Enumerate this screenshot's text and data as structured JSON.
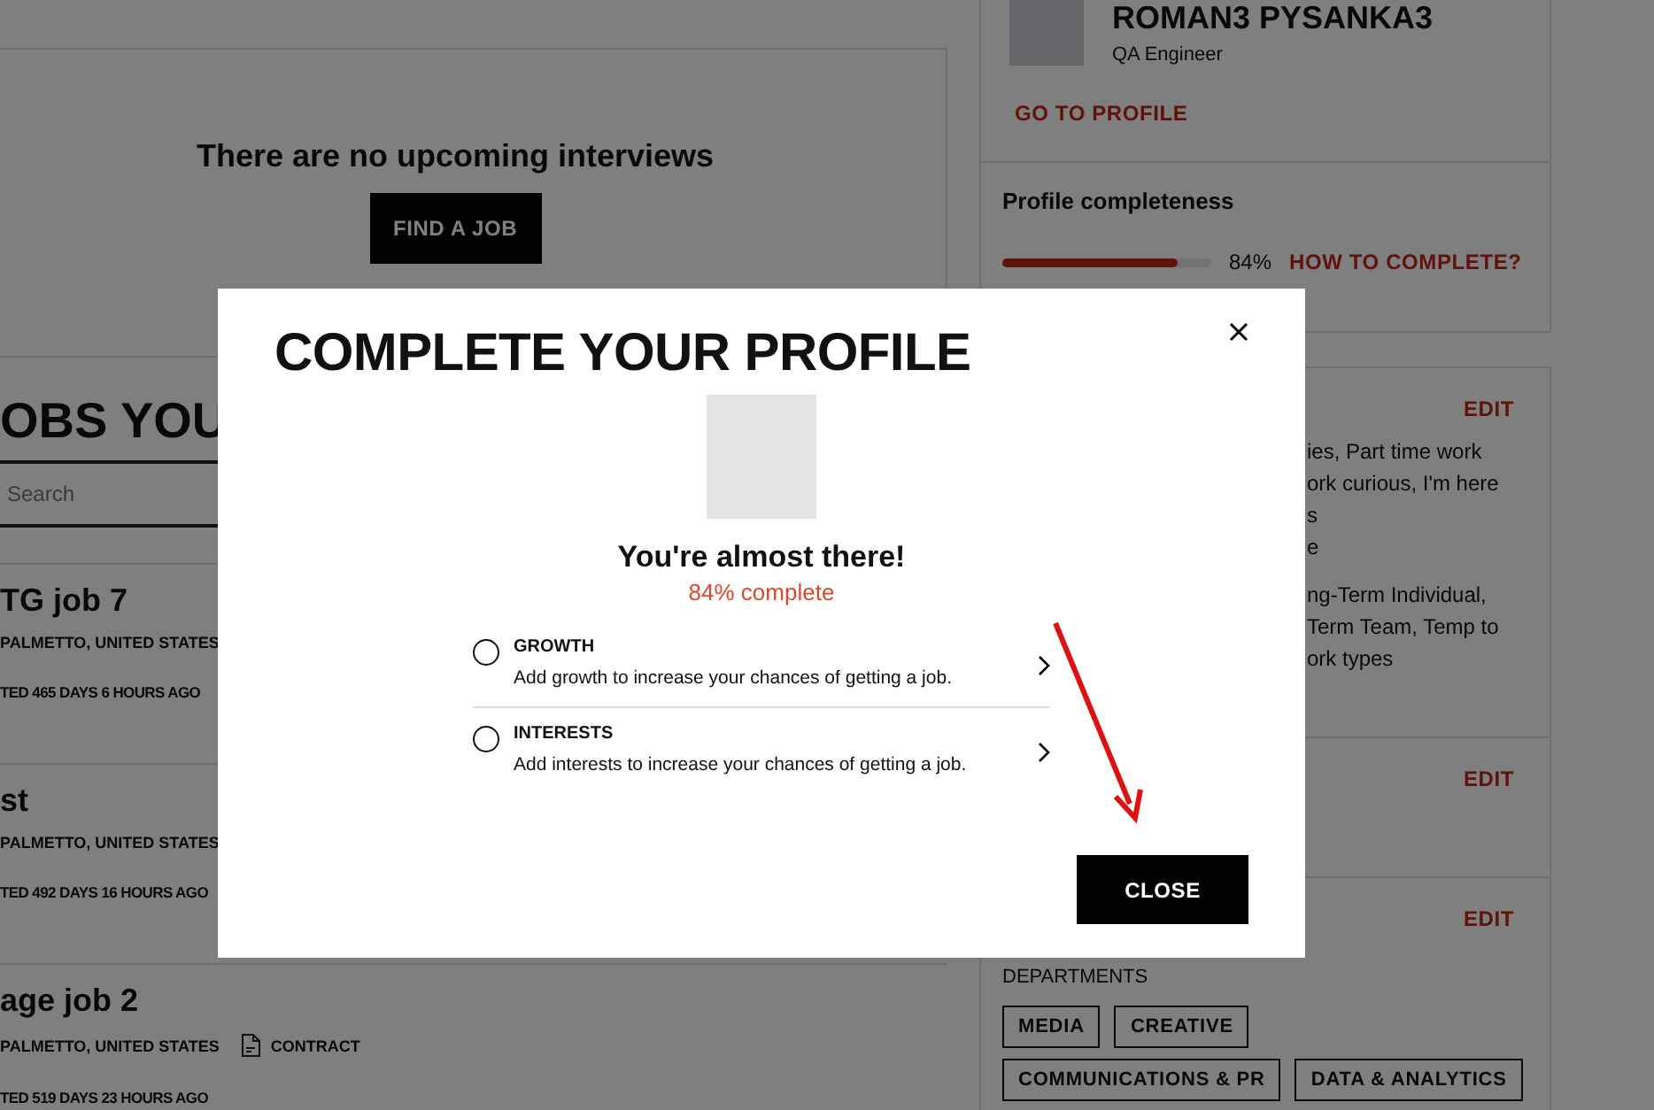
{
  "interviews": {
    "empty_message": "There are no upcoming interviews",
    "button": "FIND A JOB"
  },
  "jobs": {
    "heading": "OBS YOU",
    "search": {
      "placeholder": "Search"
    },
    "items": [
      {
        "title": "TG job 7",
        "location": "PALMETTO, UNITED STATES",
        "posted": "TED 465 DAYS 6 HOURS AGO"
      },
      {
        "title": "st",
        "location": "PALMETTO, UNITED STATES",
        "posted": "TED 492 DAYS 16 HOURS AGO"
      },
      {
        "title": "age job 2",
        "location": "PALMETTO, UNITED STATES",
        "type": "CONTRACT",
        "posted": "TED 519 DAYS 23 HOURS AGO"
      }
    ]
  },
  "profile": {
    "name": "ROMAN3 PYSANKA3",
    "role": "QA Engineer",
    "link": "GO TO PROFILE"
  },
  "completeness": {
    "title": "Profile completeness",
    "level": 0.84,
    "percent": "84%",
    "link": "HOW TO COMPLETE?"
  },
  "sections": [
    {
      "edit": "EDIT",
      "lines": [
        "ies, Part time work",
        "ork curious, I'm here",
        "s",
        "e",
        "ng-Term Individual,",
        "Term Team, Temp to",
        "ork types"
      ]
    },
    {
      "edit": "EDIT"
    },
    {
      "edit": "EDIT",
      "label": "DEPARTMENTS",
      "tags": [
        "MEDIA",
        "CREATIVE",
        "COMMUNICATIONS & PR",
        "DATA & ANALYTICS"
      ]
    }
  ],
  "modal": {
    "title": "COMPLETE YOUR PROFILE",
    "subtitle": "You're almost there!",
    "progress_text": "84% complete",
    "items": [
      {
        "title": "GROWTH",
        "description": "Add growth to increase your chances of getting a job.",
        "checked": false
      },
      {
        "title": "INTERESTS",
        "description": "Add interests to increase your chances of getting a job.",
        "checked": false
      }
    ],
    "close_button": "CLOSE"
  }
}
